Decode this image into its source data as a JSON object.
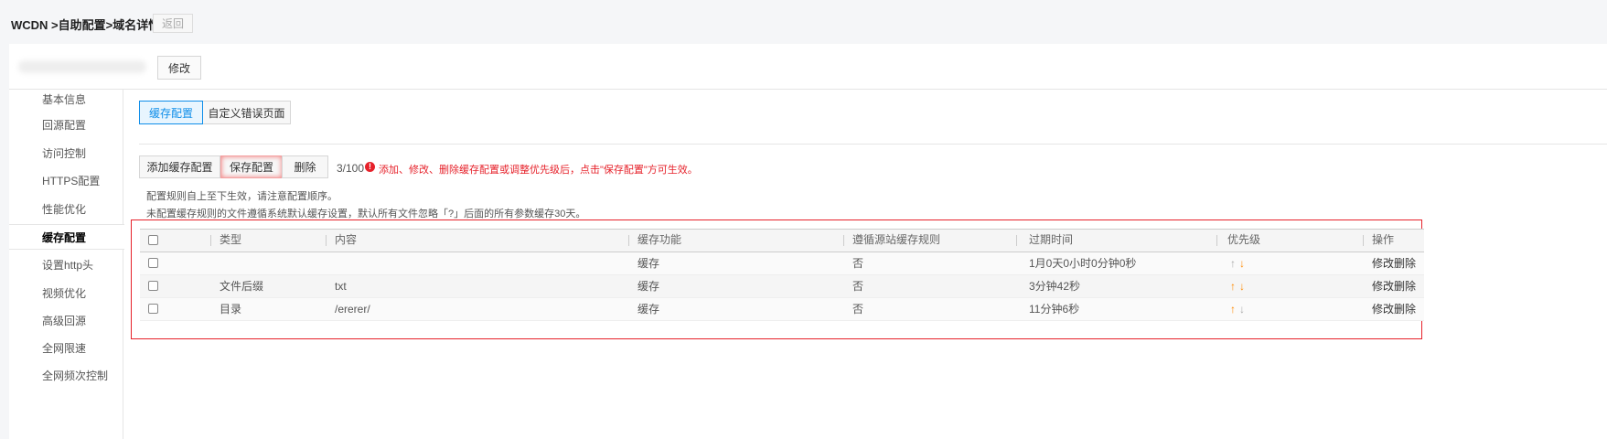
{
  "header": {
    "breadcrumb": "WCDN >自助配置>域名详情",
    "back_label": "返回"
  },
  "domain": {
    "edit_label": "修改"
  },
  "sidebar": {
    "items": [
      {
        "label": "基本信息"
      },
      {
        "label": "回源配置"
      },
      {
        "label": "访问控制"
      },
      {
        "label": "HTTPS配置"
      },
      {
        "label": "性能优化"
      },
      {
        "label": "缓存配置"
      },
      {
        "label": "设置http头"
      },
      {
        "label": "视频优化"
      },
      {
        "label": "高级回源"
      },
      {
        "label": "全网限速"
      },
      {
        "label": "全网频次控制"
      }
    ]
  },
  "tabs": [
    {
      "label": "缓存配置"
    },
    {
      "label": "自定义错误页面"
    }
  ],
  "toolbar": {
    "add_label": "添加缓存配置",
    "save_label": "保存配置",
    "delete_label": "删除",
    "count": "3/100",
    "warning": "添加、修改、删除缓存配置或调整优先级后，点击\"保存配置\"方可生效。"
  },
  "notes": [
    "配置规则自上至下生效，请注意配置顺序。",
    "未配置缓存规则的文件遵循系统默认缓存设置，默认所有文件忽略「?」后面的所有参数缓存30天。"
  ],
  "table": {
    "headers": [
      "类型",
      "内容",
      "缓存功能",
      "遵循源站缓存规则",
      "过期时间",
      "优先级",
      "操作"
    ],
    "rows": [
      {
        "type": "",
        "content": "",
        "cache": "缓存",
        "follow": "否",
        "expire": "1月0天0小时0分钟0秒",
        "up_enabled": false,
        "down_enabled": true,
        "edit": "修改",
        "delete": "删除"
      },
      {
        "type": "文件后缀",
        "content": "txt",
        "cache": "缓存",
        "follow": "否",
        "expire": "3分钟42秒",
        "up_enabled": true,
        "down_enabled": true,
        "edit": "修改",
        "delete": "删除"
      },
      {
        "type": "目录",
        "content": "/ererer/",
        "cache": "缓存",
        "follow": "否",
        "expire": "11分钟6秒",
        "up_enabled": true,
        "down_enabled": false,
        "edit": "修改",
        "delete": "删除"
      }
    ]
  },
  "colors": {
    "accent": "#0f8ee9",
    "warning": "#e6212a",
    "arrow_on": "#ff8a00",
    "arrow_off": "#aaaaaa"
  }
}
